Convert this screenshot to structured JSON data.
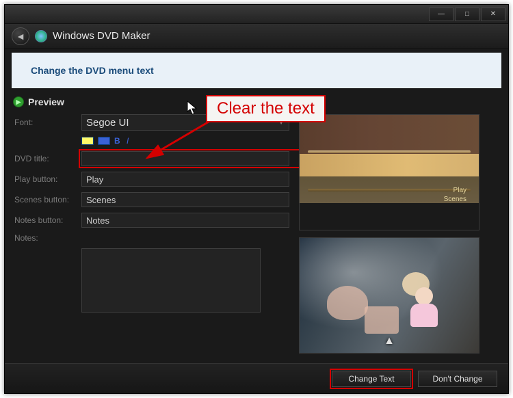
{
  "window": {
    "title": "Windows DVD Maker"
  },
  "banner": {
    "text": "Change the DVD menu text"
  },
  "preview": {
    "label": "Preview"
  },
  "form": {
    "labels": {
      "font": "Font:",
      "dvd_title": "DVD title:",
      "play_button": "Play button:",
      "scenes_button": "Scenes button:",
      "notes_button": "Notes button:",
      "notes": "Notes:"
    },
    "values": {
      "font": "Segoe UI",
      "dvd_title": "",
      "play_button": "Play",
      "scenes_button": "Scenes",
      "notes_button": "Notes",
      "notes": ""
    }
  },
  "menuPreview": {
    "play": "Play",
    "scenes": "Scenes"
  },
  "buttons": {
    "change": "Change Text",
    "dont": "Don't Change"
  },
  "annotation": {
    "text": "Clear the text"
  },
  "colors": {
    "annotation_border": "#d40000",
    "accent": "#3b62d6"
  }
}
